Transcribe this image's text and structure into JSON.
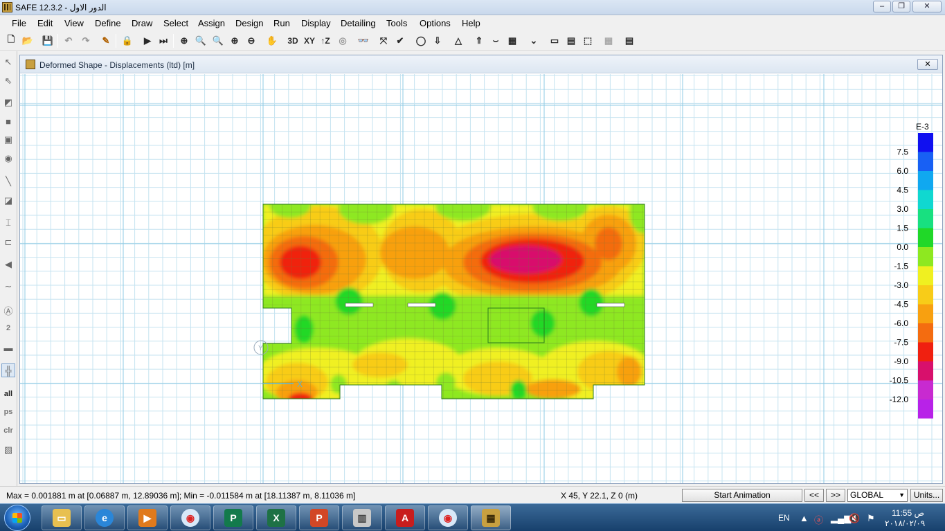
{
  "window": {
    "title": "SAFE 12.3.2 - الدور الاول"
  },
  "menu": [
    "File",
    "Edit",
    "View",
    "Define",
    "Draw",
    "Select",
    "Assign",
    "Design",
    "Run",
    "Display",
    "Detailing",
    "Tools",
    "Options",
    "Help"
  ],
  "toolbar": {
    "view_3d": "3D",
    "view_xy": "XY",
    "view_z": "↑Z"
  },
  "left_toolbar": {
    "select_all": "all",
    "select_previous": "ps",
    "clear_selection": "clr",
    "snap_label": "2"
  },
  "document": {
    "title": "Deformed Shape - Displacements (ltd)  [m]",
    "close_symbol": "✕"
  },
  "plot": {
    "legend": {
      "exponent": "E-3",
      "labels": [
        "7.5",
        "6.0",
        "4.5",
        "3.0",
        "1.5",
        "0.0",
        "-1.5",
        "-3.0",
        "-4.5",
        "-6.0",
        "-7.5",
        "-9.0",
        "-10.5",
        "-12.0"
      ],
      "colors": [
        "#0c2ce0",
        "#0b6cf2",
        "#08aee8",
        "#10ded0",
        "#19e070",
        "#2ed41a",
        "#8eef22",
        "#f8f820",
        "#f6cc1c",
        "#f6a215",
        "#f46c10",
        "#ec2a10",
        "#d80e50",
        "#c02ac0",
        "#b02ae8"
      ],
      "scale_colors": [
        "#1010f0",
        "#1860f4",
        "#10a8f0",
        "#10d8d0",
        "#18e080",
        "#20d828",
        "#8ee820",
        "#f0f020",
        "#f8cc18",
        "#f8a010",
        "#f46c10",
        "#f02010",
        "#d8106c",
        "#c82ad0",
        "#b822e8"
      ]
    },
    "axis_x_label": "X",
    "axis_y_label": "Y"
  },
  "status": {
    "max_min": "Max = 0.001881 m at [0.06887 m, 12.89036 m];  Min = -0.011584 m at [18.11387 m, 8.11036 m]",
    "coords": "X 45,  Y 22.1,  Z 0  (m)",
    "start_animation": "Start Animation",
    "prev": "<<",
    "next": ">>",
    "coord_system": "GLOBAL",
    "units": "Units..."
  },
  "taskbar": {
    "language": "EN",
    "time": "11:55 ص",
    "date": "٢٠١٨/٠٢/٠٩"
  }
}
